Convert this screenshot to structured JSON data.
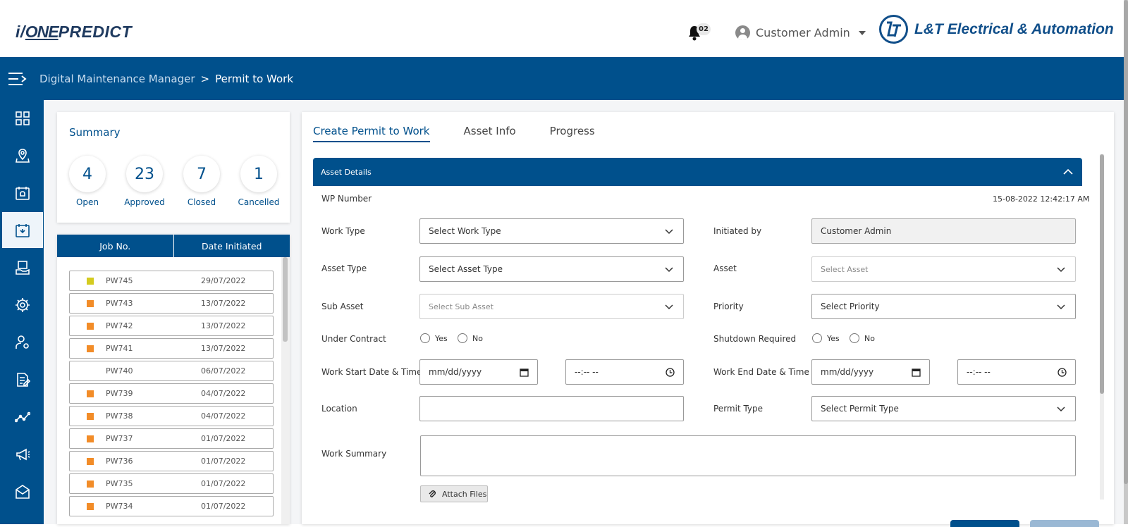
{
  "app": {
    "logo_text_prefix": "i/",
    "logo_text_one": "ONE",
    "logo_text_suffix": "PREDICT",
    "notification_count": "02",
    "user_name": "Customer Admin",
    "brand_name": "L&T Electrical & Automation"
  },
  "breadcrumb": {
    "parent": "Digital Maintenance Manager",
    "separator": ">",
    "current": "Permit to Work"
  },
  "sidebar": {
    "items": [
      {
        "icon": "dashboard-grid-icon"
      },
      {
        "icon": "map-location-icon"
      },
      {
        "icon": "calendar-alarm-icon"
      },
      {
        "icon": "maintenance-tools-icon",
        "active": true
      },
      {
        "icon": "inventory-hand-icon"
      },
      {
        "icon": "settings-gear-icon"
      },
      {
        "icon": "user-settings-icon"
      },
      {
        "icon": "document-edit-icon"
      },
      {
        "icon": "analytics-trend-icon"
      },
      {
        "icon": "announcement-megaphone-icon"
      },
      {
        "icon": "mail-icon"
      }
    ]
  },
  "summary": {
    "title": "Summary",
    "stats": [
      {
        "value": "4",
        "label": "Open"
      },
      {
        "value": "23",
        "label": "Approved"
      },
      {
        "value": "7",
        "label": "Closed"
      },
      {
        "value": "1",
        "label": "Cancelled"
      }
    ]
  },
  "joblist": {
    "headers": [
      "Job No.",
      "Date Initiated"
    ],
    "rows": [
      {
        "job": "PW745",
        "date": "29/07/2022",
        "status_color": "#d4cb1f"
      },
      {
        "job": "PW743",
        "date": "13/07/2022",
        "status_color": "#f28c28"
      },
      {
        "job": "PW742",
        "date": "13/07/2022",
        "status_color": "#f28c28"
      },
      {
        "job": "PW741",
        "date": "13/07/2022",
        "status_color": "#f28c28"
      },
      {
        "job": "PW740",
        "date": "06/07/2022",
        "status_color": ""
      },
      {
        "job": "PW739",
        "date": "04/07/2022",
        "status_color": "#f28c28"
      },
      {
        "job": "PW738",
        "date": "04/07/2022",
        "status_color": "#f28c28"
      },
      {
        "job": "PW737",
        "date": "01/07/2022",
        "status_color": "#f28c28"
      },
      {
        "job": "PW736",
        "date": "01/07/2022",
        "status_color": "#f28c28"
      },
      {
        "job": "PW735",
        "date": "01/07/2022",
        "status_color": "#f28c28"
      },
      {
        "job": "PW734",
        "date": "01/07/2022",
        "status_color": "#f28c28"
      }
    ]
  },
  "tabs": [
    "Create Permit to Work",
    "Asset Info",
    "Progress"
  ],
  "form": {
    "section_title": "Asset Details",
    "wp_number_label": "WP Number",
    "timestamp": "15-08-2022 12:42:17 AM",
    "work_type_label": "Work Type",
    "work_type_value": "Select Work Type",
    "initiated_by_label": "Initiated by",
    "initiated_by_value": "Customer Admin",
    "asset_type_label": "Asset Type",
    "asset_type_value": "Select Asset Type",
    "asset_label": "Asset",
    "asset_value": "Select Asset",
    "sub_asset_label": "Sub Asset",
    "sub_asset_value": "Select Sub Asset",
    "priority_label": "Priority",
    "priority_value": "Select Priority",
    "under_contract_label": "Under Contract",
    "shutdown_label": "Shutdown Required",
    "yes": "Yes",
    "no": "No",
    "start_label": "Work Start Date & Time",
    "end_label": "Work End Date & Time",
    "date_placeholder": "mm/dd/yyyy",
    "time_placeholder": "--:-- --",
    "location_label": "Location",
    "location_value": "",
    "permit_type_label": "Permit Type",
    "permit_type_value": "Select Permit Type",
    "work_summary_label": "Work Summary",
    "attach_label": "Attach Files"
  },
  "colors": {
    "primary": "#00508c",
    "status_yellow": "#d4cb1f",
    "status_orange": "#f28c28"
  }
}
